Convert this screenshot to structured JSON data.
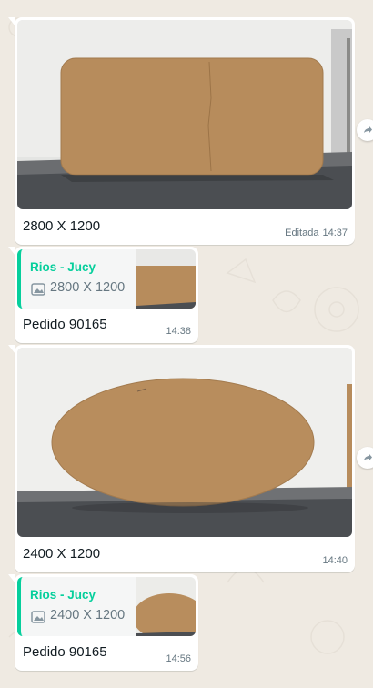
{
  "messages": [
    {
      "type": "image",
      "caption": "2800 X 1200",
      "edited_label": "Editada",
      "time": "14:37"
    },
    {
      "type": "reply",
      "quote_author": "Rios - Jucy",
      "quote_text": "2800 X 1200",
      "body": "Pedido 90165",
      "time": "14:38"
    },
    {
      "type": "image",
      "caption": "2400 X 1200",
      "time": "14:40"
    },
    {
      "type": "reply",
      "quote_author": "Rios - Jucy",
      "quote_text": "2400 X 1200",
      "body": "Pedido 90165",
      "time": "14:56"
    }
  ],
  "icons": [
    "photo-icon",
    "forward-icon"
  ],
  "colors": {
    "background": "#efeae2",
    "bubble": "#ffffff",
    "quote_accent": "#06cf9c",
    "meta_text": "#667781"
  }
}
